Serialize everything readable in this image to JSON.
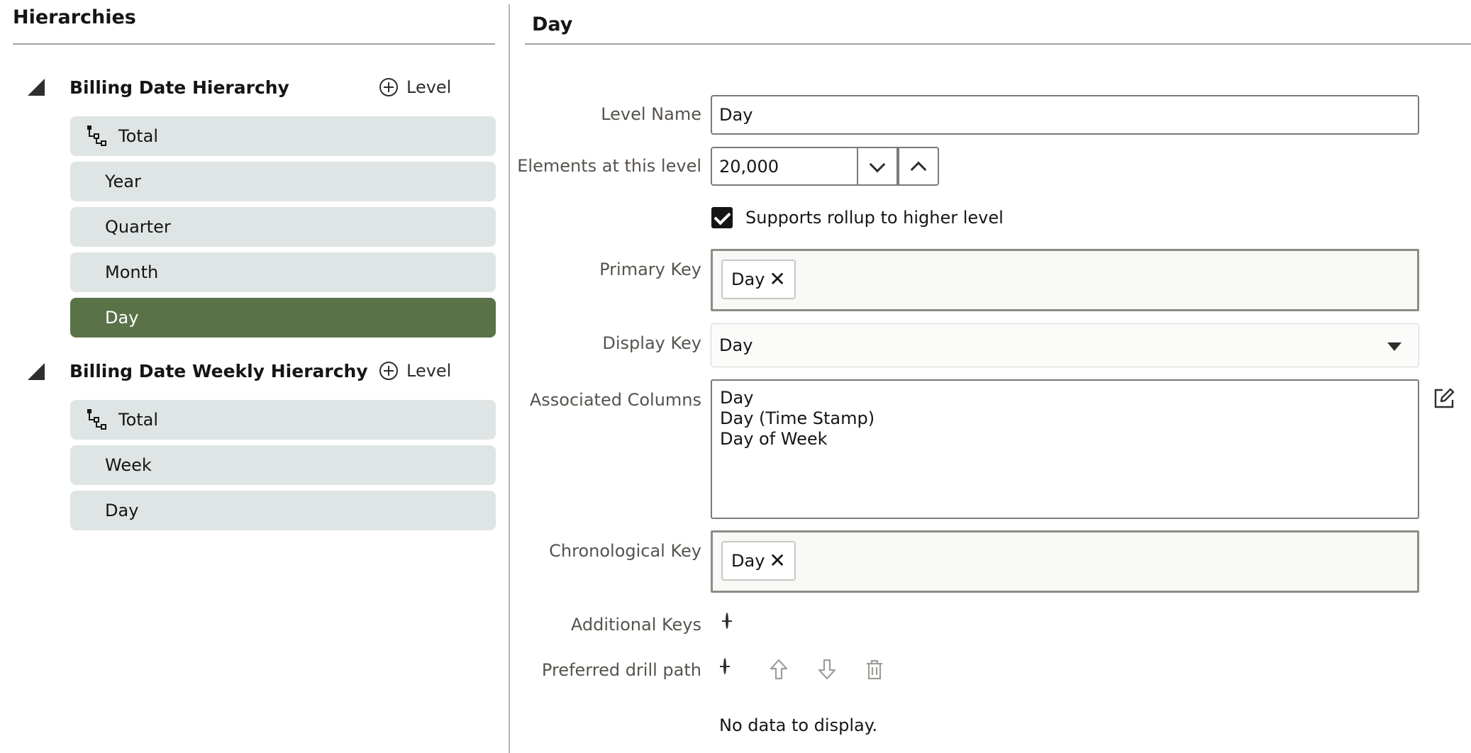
{
  "hierarchies_panel": {
    "title": "Hierarchies",
    "add_level_label": "Level",
    "hierarchies": [
      {
        "name": "Billing Date Hierarchy",
        "levels": [
          "Total",
          "Year",
          "Quarter",
          "Month",
          "Day"
        ],
        "selected": "Day"
      },
      {
        "name": "Billing Date Weekly Hierarchy",
        "levels": [
          "Total",
          "Week",
          "Day"
        ]
      }
    ]
  },
  "detail": {
    "title": "Day",
    "level_name": {
      "label": "Level Name",
      "value": "Day"
    },
    "elements": {
      "label": "Elements at this level",
      "value": "20,000"
    },
    "rollup": {
      "label": "Supports rollup to higher level",
      "checked": true
    },
    "primary_key": {
      "label": "Primary Key",
      "chips": [
        "Day"
      ]
    },
    "display_key": {
      "label": "Display Key",
      "value": "Day"
    },
    "associated_columns": {
      "label": "Associated Columns",
      "items": [
        "Day",
        "Day (Time Stamp)",
        "Day of Week"
      ]
    },
    "chronological_key": {
      "label": "Chronological Key",
      "chips": [
        "Day"
      ]
    },
    "additional_keys": {
      "label": "Additional Keys"
    },
    "preferred_drill_path": {
      "label": "Preferred drill path",
      "empty_text": "No data to display."
    }
  },
  "icons": {
    "collapse": "collapse-triangle-icon",
    "add": "plus-circle-icon",
    "total": "hierarchy-tree-icon",
    "remove": "close-icon",
    "edit": "edit-icon",
    "move_up": "arrow-up-icon",
    "move_down": "arrow-down-icon",
    "delete": "trash-icon"
  },
  "colors": {
    "level_bg": "#dfe5e4",
    "selected_level_bg": "#5a7248"
  }
}
